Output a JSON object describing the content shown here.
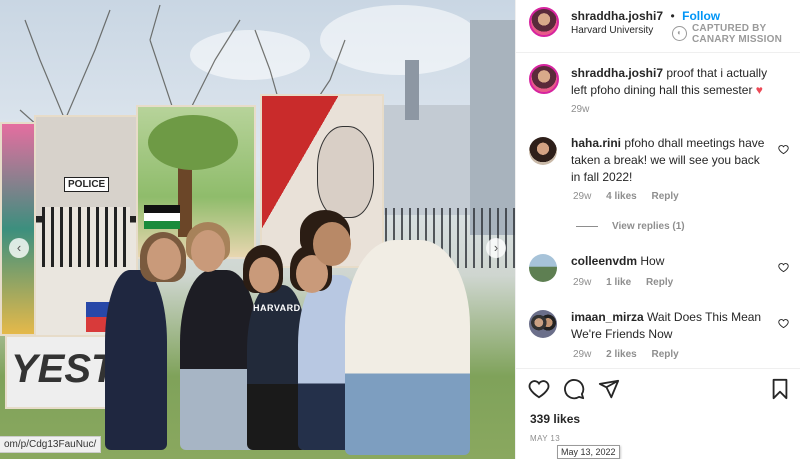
{
  "post": {
    "author": "shraddha.joshi7",
    "follow_label": "Follow",
    "separator": "•",
    "location": "Harvard University",
    "caption": "proof that i actually left pfoho dining hall this semester",
    "caption_emoji": "♥",
    "caption_age": "29w",
    "likes": "339 likes",
    "date": "MAY 13",
    "date_tooltip": "May 13, 2022"
  },
  "watermark": {
    "line1": "CAPTURED BY",
    "line2": "CANARY MISSION"
  },
  "photo": {
    "signs": [
      "POLICE",
      "YEST"
    ],
    "shirt_text": "HARVARD",
    "url_fragment": "om/p/Cdg13FauNuc/"
  },
  "comments": [
    {
      "user": "haha.rini",
      "text": "pfoho dhall meetings have taken a break! we will see you back in fall 2022!",
      "age": "29w",
      "likes": "4 likes",
      "reply": "Reply",
      "view_replies": "View replies (1)"
    },
    {
      "user": "colleenvdm",
      "text": "How",
      "age": "29w",
      "likes": "1 like",
      "reply": "Reply"
    },
    {
      "user": "imaan_mirza",
      "text": "Wait Does This Mean We're Friends Now",
      "age": "29w",
      "likes": "2 likes",
      "reply": "Reply"
    }
  ],
  "icons": {
    "like": "heart-icon",
    "comment": "comment-icon",
    "share": "paper-plane-icon",
    "save": "bookmark-icon",
    "prev": "chevron-left-icon",
    "next": "chevron-right-icon"
  },
  "colors": {
    "follow_blue": "#0095f6",
    "heart_red": "#ed4956",
    "muted_gray": "#8e8e8e"
  }
}
